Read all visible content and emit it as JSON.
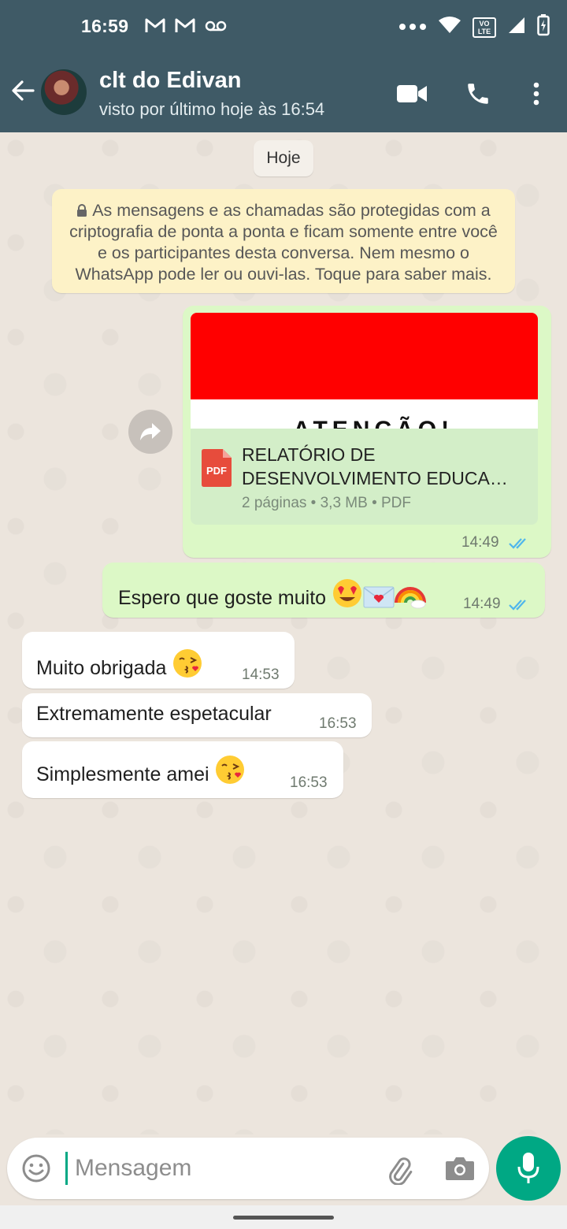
{
  "status_bar": {
    "time": "16:59",
    "notification_icons": [
      "gmail-icon",
      "gmail-icon",
      "voicemail-icon"
    ],
    "system_icons": [
      "more-dots-icon",
      "wifi-icon",
      "volte-icon",
      "signal-icon",
      "battery-charging-icon"
    ],
    "volte_label": "VO LTE"
  },
  "header": {
    "title": "clt do Edivan",
    "subtitle": "visto por último hoje às 16:54",
    "actions": [
      "video-call-icon",
      "phone-icon",
      "more-vert-icon"
    ]
  },
  "chat": {
    "date_label": "Hoje",
    "encryption_notice": "As mensagens e as chamadas são protegidas com a criptografia de ponta a ponta e ficam somente entre você e os participantes desta conversa. Nem mesmo o WhatsApp pode ler ou ouvi-las. Toque para saber mais.",
    "messages": [
      {
        "type": "document",
        "direction": "out",
        "file_badge": "PDF",
        "file_name_line1": "RELATÓRIO DE",
        "file_name_line2": "DESENVOLVIMENTO EDUCA…",
        "file_meta": "2 páginas • 3,3 MB • PDF",
        "time": "14:49",
        "read": true
      },
      {
        "type": "text",
        "direction": "out",
        "text": "Espero que goste muito",
        "emojis": [
          "heart-eyes-emoji",
          "love-letter-emoji",
          "rainbow-emoji"
        ],
        "time": "14:49",
        "read": true
      },
      {
        "type": "text",
        "direction": "in",
        "text": "Muito obrigada",
        "emojis": [
          "kiss-emoji"
        ],
        "time": "14:53"
      },
      {
        "type": "text",
        "direction": "in",
        "text": "Extremamente espetacular",
        "time": "16:53"
      },
      {
        "type": "text",
        "direction": "in",
        "text": "Simplesmente amei",
        "emojis": [
          "kiss-emoji"
        ],
        "time": "16:53"
      }
    ]
  },
  "composer": {
    "placeholder": "Mensagem",
    "icons": [
      "emoji-icon",
      "attach-icon",
      "camera-icon",
      "mic-icon"
    ]
  },
  "colors": {
    "header": "#3f5a66",
    "outgoing_bubble": "#dcf8c6",
    "incoming_bubble": "#ffffff",
    "accent": "#00a884",
    "read_ticks": "#4fb6ec"
  }
}
